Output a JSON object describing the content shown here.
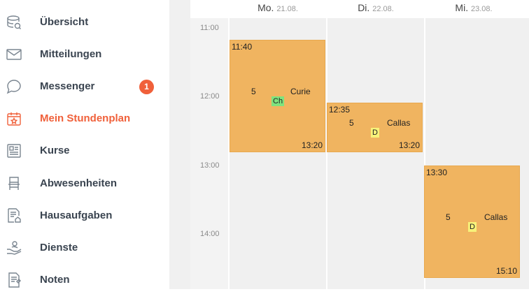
{
  "sidebar": {
    "items": [
      {
        "label": "Übersicht",
        "icon": "overview-icon"
      },
      {
        "label": "Mitteilungen",
        "icon": "envelope-icon"
      },
      {
        "label": "Messenger",
        "icon": "chat-bubble-icon",
        "badge": "1"
      },
      {
        "label": "Mein Stundenplan",
        "icon": "calendar-icon",
        "active": true
      },
      {
        "label": "Kurse",
        "icon": "courses-icon"
      },
      {
        "label": "Abwesenheiten",
        "icon": "chair-icon"
      },
      {
        "label": "Hausaufgaben",
        "icon": "homework-icon"
      },
      {
        "label": "Dienste",
        "icon": "service-hand-icon"
      },
      {
        "label": "Noten",
        "icon": "grades-icon"
      }
    ]
  },
  "calendar": {
    "times": [
      "11:00",
      "12:00",
      "13:00",
      "14:00"
    ],
    "days": [
      {
        "name": "Mo.",
        "date": "21.08."
      },
      {
        "name": "Di.",
        "date": "22.08."
      },
      {
        "name": "Mi.",
        "date": "23.08."
      }
    ],
    "events": [
      {
        "start": "11:40",
        "end": "13:20",
        "room": "5",
        "teacher": "Curie",
        "subject": "Ch",
        "subject_color": "#7ee37e"
      },
      {
        "start": "12:35",
        "end": "13:20",
        "room": "5",
        "teacher": "Callas",
        "subject": "D",
        "subject_color": "#f7f27a"
      },
      {
        "start": "13:30",
        "end": "15:10",
        "room": "5",
        "teacher": "Callas",
        "subject": "D",
        "subject_color": "#f7f27a"
      }
    ]
  },
  "colors": {
    "accent": "#f0603a",
    "event": "#f0b460"
  }
}
